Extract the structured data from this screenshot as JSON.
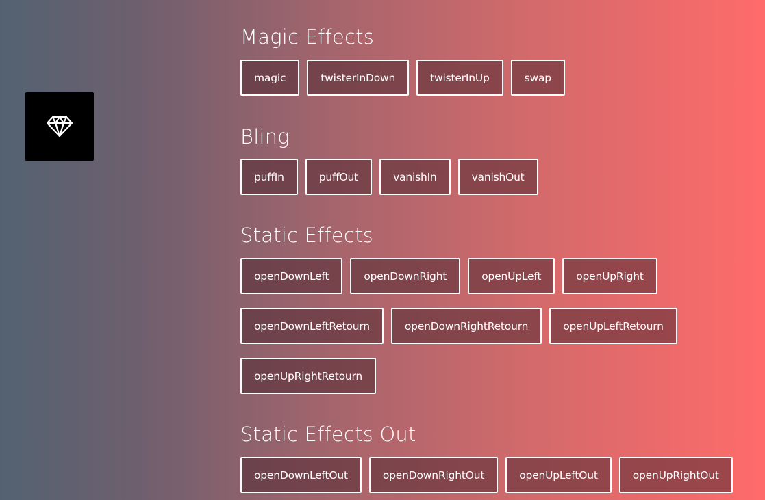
{
  "preview": {
    "icon": "diamond-icon"
  },
  "sections": [
    {
      "title": "Magic Effects",
      "rows": [
        [
          "magic",
          "twisterInDown",
          "twisterInUp",
          "swap"
        ]
      ]
    },
    {
      "title": "Bling",
      "rows": [
        [
          "puffIn",
          "puffOut",
          "vanishIn",
          "vanishOut"
        ]
      ]
    },
    {
      "title": "Static Effects",
      "rows": [
        [
          "openDownLeft",
          "openDownRight",
          "openUpLeft",
          "openUpRight"
        ],
        [
          "openDownLeftRetourn",
          "openDownRightRetourn",
          "openUpLeftRetourn"
        ],
        [
          "openUpRightRetourn"
        ]
      ]
    },
    {
      "title": "Static Effects Out",
      "rows": [
        [
          "openDownLeftOut",
          "openDownRightOut",
          "openUpLeftOut",
          "openUpRightOut"
        ]
      ]
    }
  ]
}
